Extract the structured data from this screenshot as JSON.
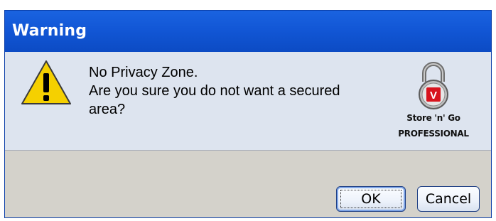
{
  "window": {
    "title": "Warning"
  },
  "icons": {
    "warning": "warning-triangle-icon",
    "lock": "padlock-icon"
  },
  "message": {
    "line1": "No Privacy Zone.",
    "line2": "Are you sure you do not want a secured",
    "line3": "area?"
  },
  "brand": {
    "logo_letter": "V",
    "line1": "Store 'n' Go",
    "line2": "PROFESSIONAL"
  },
  "buttons": {
    "ok_label": "OK",
    "cancel_label": "Cancel"
  },
  "colors": {
    "titlebar": "#1257d6",
    "content_bg": "#dde4ef",
    "footer_bg": "#d4d2cb",
    "warning_yellow": "#f5d000",
    "logo_red": "#d8141d"
  }
}
